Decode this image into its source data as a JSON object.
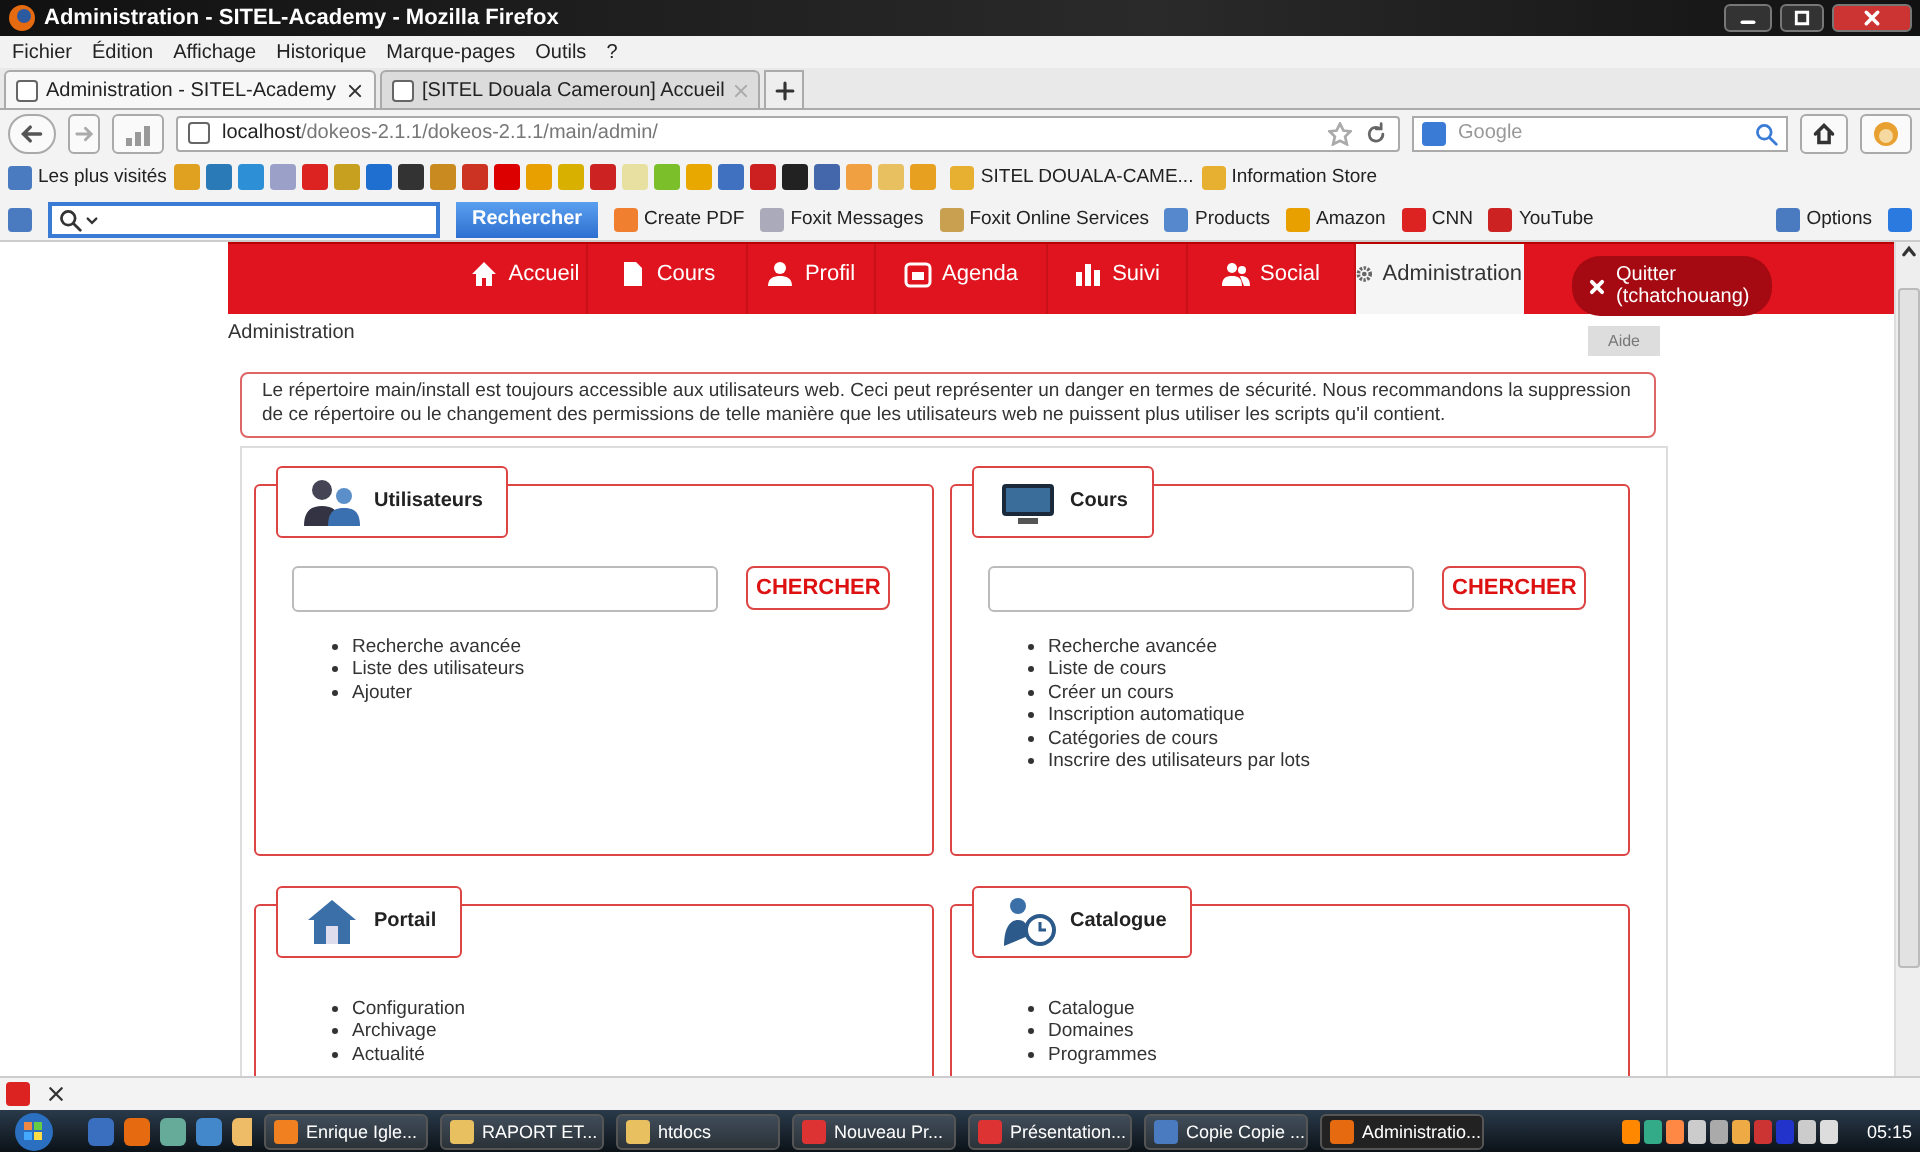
{
  "window": {
    "title": "Administration - SITEL-Academy - Mozilla Firefox"
  },
  "menu": [
    "Fichier",
    "Édition",
    "Affichage",
    "Historique",
    "Marque-pages",
    "Outils",
    "?"
  ],
  "tabs": [
    {
      "label": "Administration - SITEL-Academy",
      "selected": true
    },
    {
      "label": "[SITEL Douala Cameroun] Accueil",
      "selected": false
    }
  ],
  "address": {
    "host": "localhost",
    "path": "/dokeos-2.1.1/dokeos-2.1.1/main/admin/"
  },
  "search": {
    "placeholder": "Google"
  },
  "bookmarks": {
    "label": "Les plus visités",
    "items": [
      "SITEL DOUALA-CAME...",
      "Information Store"
    ]
  },
  "ask_toolbar": {
    "button": "Rechercher",
    "items": [
      "Create PDF",
      "Foxit Messages",
      "Foxit Online Services",
      "Products",
      "Amazon",
      "CNN",
      "YouTube"
    ],
    "options": "Options"
  },
  "site_nav": [
    {
      "label": "Accueil",
      "selected": false
    },
    {
      "label": "Cours",
      "selected": false
    },
    {
      "label": "Profil",
      "selected": false
    },
    {
      "label": "Agenda",
      "selected": false
    },
    {
      "label": "Suivi",
      "selected": false
    },
    {
      "label": "Social",
      "selected": false
    },
    {
      "label": "Administration",
      "selected": true
    }
  ],
  "quit": "Quitter (tchatchouang)",
  "breadcrumb": "Administration",
  "help": "Aide",
  "alert": "Le répertoire main/install est toujours accessible aux utilisateurs web. Ceci peut représenter un danger en termes de sécurité. Nous recommandons la suppression de ce répertoire ou le changement des permissions de telle manière que les utilisateurs web ne puissent plus utiliser les scripts qu'il contient.",
  "panels": [
    {
      "title": "Utilisateurs",
      "search_button": "CHERCHER",
      "links": [
        "Recherche avancée",
        "Liste des utilisateurs",
        "Ajouter"
      ]
    },
    {
      "title": "Cours",
      "search_button": "CHERCHER",
      "links": [
        "Recherche avancée",
        "Liste de cours",
        "Créer un cours",
        "Inscription automatique",
        "Catégories de cours",
        "Inscrire des utilisateurs par lots"
      ]
    },
    {
      "title": "Portail",
      "links": [
        "Configuration",
        "Archivage",
        "Actualité"
      ]
    },
    {
      "title": "Catalogue",
      "links": [
        "Catalogue",
        "Domaines",
        "Programmes"
      ]
    }
  ],
  "taskbar": [
    {
      "label": "Enrique Igle...",
      "selected": false
    },
    {
      "label": "RAPORT  ET...",
      "selected": false
    },
    {
      "label": "htdocs",
      "selected": false
    },
    {
      "label": "Nouveau Pr...",
      "selected": false
    },
    {
      "label": "Présentation...",
      "selected": false
    },
    {
      "label": "Copie Copie ...",
      "selected": false
    },
    {
      "label": "Administratio...",
      "selected": true
    }
  ],
  "clock": "05:15"
}
